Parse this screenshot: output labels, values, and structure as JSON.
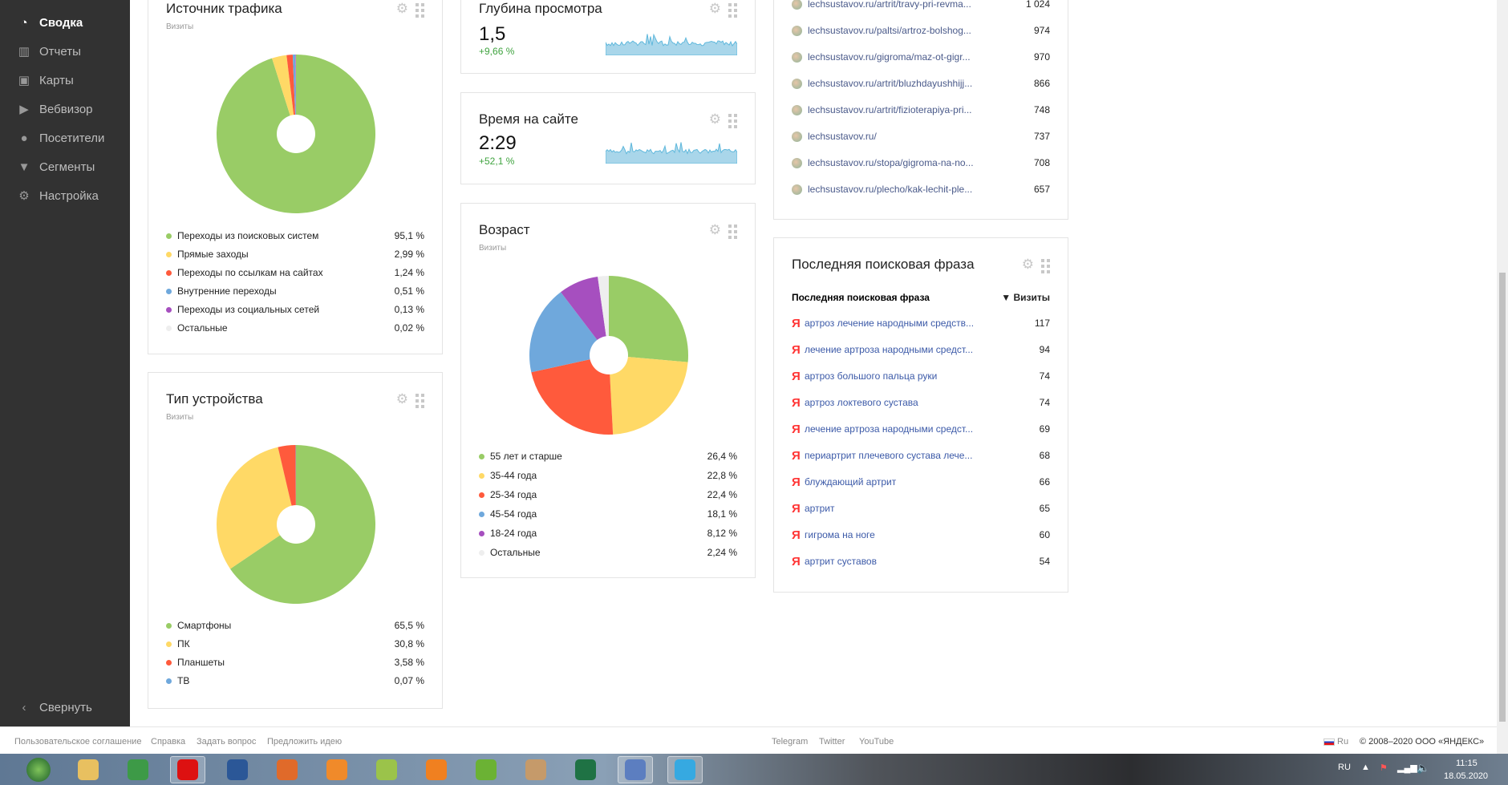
{
  "sidebar": {
    "items": [
      {
        "label": "Сводка",
        "icon": "gauge-icon",
        "glyph": "◔",
        "active": true
      },
      {
        "label": "Отчеты",
        "icon": "bar-chart-icon",
        "glyph": "▥"
      },
      {
        "label": "Карты",
        "icon": "map-layout-icon",
        "glyph": "▣"
      },
      {
        "label": "Вебвизор",
        "icon": "play-icon",
        "glyph": "▶"
      },
      {
        "label": "Посетители",
        "icon": "user-icon",
        "glyph": "●"
      },
      {
        "label": "Сегменты",
        "icon": "filter-icon",
        "glyph": "▼"
      },
      {
        "label": "Настройка",
        "icon": "gear-icon",
        "glyph": "⚙"
      }
    ],
    "collapse": "Свернуть",
    "collapse_glyph": "‹"
  },
  "widgets": {
    "traffic": {
      "title": "Источник трафика",
      "sub": "Визиты"
    },
    "device": {
      "title": "Тип устройства",
      "sub": "Визиты"
    },
    "age": {
      "title": "Возраст",
      "sub": "Визиты"
    },
    "depth": {
      "title": "Глубина просмотра",
      "value": "1,5",
      "change": "+9,66 %"
    },
    "time": {
      "title": "Время на сайте",
      "value": "2:29",
      "change": "+52,1 %"
    },
    "pages": {
      "rows": [
        {
          "url": "lechsustavov.ru/artrit/travy-pri-revma...",
          "n": "1 024"
        },
        {
          "url": "lechsustavov.ru/paltsi/artroz-bolshog...",
          "n": "974"
        },
        {
          "url": "lechsustavov.ru/gigroma/maz-ot-gigr...",
          "n": "970"
        },
        {
          "url": "lechsustavov.ru/artrit/bluzhdayushhijj...",
          "n": "866"
        },
        {
          "url": "lechsustavov.ru/artrit/fizioterapiya-pri...",
          "n": "748"
        },
        {
          "url": "lechsustavov.ru/",
          "n": "737"
        },
        {
          "url": "lechsustavov.ru/stopa/gigroma-na-no...",
          "n": "708"
        },
        {
          "url": "lechsustavov.ru/plecho/kak-lechit-ple...",
          "n": "657"
        }
      ]
    },
    "phrases": {
      "title": "Последняя поисковая фраза",
      "col1": "Последняя поисковая фраза",
      "col2": "▼ Визиты",
      "rows": [
        {
          "q": "артроз лечение народными средств...",
          "n": "117"
        },
        {
          "q": "лечение артроза народными средст...",
          "n": "94"
        },
        {
          "q": "артроз большого пальца руки",
          "n": "74"
        },
        {
          "q": "артроз локтевого сустава",
          "n": "74"
        },
        {
          "q": "лечение артроза народными средст...",
          "n": "69"
        },
        {
          "q": "периартрит плечевого сустава лече...",
          "n": "68"
        },
        {
          "q": "блуждающий артрит",
          "n": "66"
        },
        {
          "q": "артрит",
          "n": "65"
        },
        {
          "q": "гигрома на ноге",
          "n": "60"
        },
        {
          "q": "артрит суставов",
          "n": "54"
        }
      ]
    }
  },
  "chart_data": [
    {
      "type": "pie",
      "title": "Источник трафика",
      "unit": "%",
      "categories": [
        "Переходы из поисковых систем",
        "Прямые заходы",
        "Переходы по ссылкам на сайтах",
        "Внутренние переходы",
        "Переходы из социальных сетей",
        "Остальные"
      ],
      "values": [
        95.1,
        2.99,
        1.24,
        0.51,
        0.13,
        0.02
      ],
      "labels": [
        "95,1 %",
        "2,99 %",
        "1,24 %",
        "0,51 %",
        "0,13 %",
        "0,02 %"
      ],
      "colors": [
        "#99cc66",
        "#ffd966",
        "#ff5a3c",
        "#6fa8dc",
        "#a64fbf",
        "#eeeeee"
      ]
    },
    {
      "type": "pie",
      "title": "Тип устройства",
      "unit": "%",
      "categories": [
        "Смартфоны",
        "ПК",
        "Планшеты",
        "ТВ"
      ],
      "values": [
        65.5,
        30.8,
        3.58,
        0.07
      ],
      "labels": [
        "65,5 %",
        "30,8 %",
        "3,58 %",
        "0,07 %"
      ],
      "colors": [
        "#99cc66",
        "#ffd966",
        "#ff5a3c",
        "#6fa8dc"
      ]
    },
    {
      "type": "pie",
      "title": "Возраст",
      "unit": "%",
      "categories": [
        "55 лет и старше",
        "35-44 года",
        "25-34 года",
        "45-54 года",
        "18-24 года",
        "Остальные"
      ],
      "values": [
        26.4,
        22.8,
        22.4,
        18.1,
        8.12,
        2.24
      ],
      "labels": [
        "26,4 %",
        "22,8 %",
        "22,4 %",
        "18,1 %",
        "8,12 %",
        "2,24 %"
      ],
      "colors": [
        "#99cc66",
        "#ffd966",
        "#ff5a3c",
        "#6fa8dc",
        "#a64fbf",
        "#eeeeee"
      ]
    }
  ],
  "footer": {
    "left": [
      "Пользовательское соглашение",
      "Справка",
      "Задать вопрос",
      "Предложить идею"
    ],
    "center": [
      "Telegram",
      "Twitter",
      "YouTube"
    ],
    "lang": "Ru",
    "copyright": "© 2008–2020 ООО «ЯНДЕКС»"
  },
  "taskbar": {
    "lang": "RU",
    "time": "11:15",
    "date": "18.05.2020",
    "apps": [
      {
        "name": "explorer",
        "color": "#e8c060"
      },
      {
        "name": "chrome",
        "color": "#3d9a47"
      },
      {
        "name": "opera",
        "color": "#d11"
      },
      {
        "name": "word",
        "color": "#2b5797"
      },
      {
        "name": "picture-viewer",
        "color": "#e06a2a"
      },
      {
        "name": "media-player",
        "color": "#f08a2a"
      },
      {
        "name": "game",
        "color": "#9bc34a"
      },
      {
        "name": "vlc",
        "color": "#f08020"
      },
      {
        "name": "utorrent",
        "color": "#6bb234"
      },
      {
        "name": "archiver",
        "color": "#c59a6a"
      },
      {
        "name": "excel",
        "color": "#1f7244"
      },
      {
        "name": "remote-desktop",
        "color": "#5c7ec0"
      },
      {
        "name": "app-24",
        "color": "#36a9e1"
      }
    ]
  }
}
